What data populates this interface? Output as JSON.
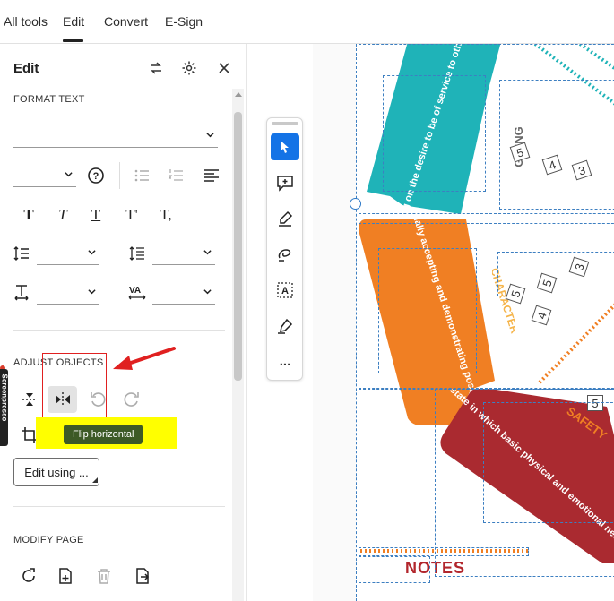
{
  "tabs": [
    {
      "label": "All tools"
    },
    {
      "label": "Edit"
    },
    {
      "label": "Convert"
    },
    {
      "label": "E-Sign"
    }
  ],
  "panel": {
    "title": "Edit",
    "format_text_label": "FORMAT TEXT",
    "adjust_objects_label": "ADJUST OBJECTS",
    "modify_page_label": "MODIFY PAGE",
    "edit_using_label": "Edit using ...",
    "tooltip": "Flip horizontal",
    "side_tab_text": "Screenpresso"
  },
  "text_buttons": [
    "T",
    "T",
    "T",
    "T'",
    "T,"
  ],
  "vertical_toolbar": {
    "more_label": "..."
  },
  "document": {
    "teal_text": "Acting on the desire to be of service to others",
    "giving_label": "GIVING",
    "orange_text": "Personally accepting and demonstrating positive values",
    "character_label": "CHARACTER",
    "red_text": "The state in which basic physical and emotional needs are being met",
    "safety_label": "SAFETY",
    "notes_label": "NOTES",
    "numbers": [
      "5",
      "4",
      "3",
      "5",
      "4",
      "3",
      "5",
      "5"
    ]
  },
  "colors": {
    "teal": "#1fb3b8",
    "orange": "#f07f23",
    "red": "#aa2a30",
    "accent": "#1473e6",
    "tooltip_bg": "#3d5a26",
    "highlight": "#ffff00",
    "annotation_red": "#e02020"
  }
}
